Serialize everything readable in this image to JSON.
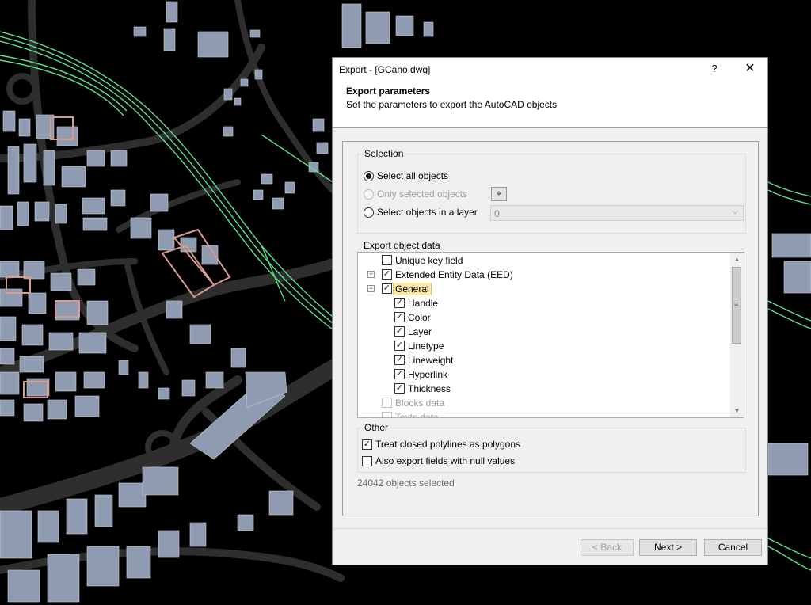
{
  "dialog": {
    "title": "Export - [GCano.dwg]",
    "help": "?",
    "close": "✕",
    "header_title": "Export parameters",
    "header_subtitle": "Set the parameters to export the AutoCAD objects"
  },
  "selection": {
    "group_label": "Selection",
    "all_objects": "Select all objects",
    "only_selected": "Only selected objects",
    "in_layer": "Select objects in a layer",
    "layer_value": "0",
    "selected_option": "all_objects"
  },
  "export_data": {
    "group_label": "Export object data",
    "items": [
      {
        "label": "Unique key field",
        "checked": false,
        "disabled": false
      },
      {
        "label": "Extended Entity Data (EED)",
        "checked": true,
        "disabled": false
      },
      {
        "label": "General",
        "checked": true,
        "disabled": false
      },
      {
        "label": "Handle",
        "checked": true,
        "disabled": false
      },
      {
        "label": "Color",
        "checked": true,
        "disabled": false
      },
      {
        "label": "Layer",
        "checked": true,
        "disabled": false
      },
      {
        "label": "Linetype",
        "checked": true,
        "disabled": false
      },
      {
        "label": "Lineweight",
        "checked": true,
        "disabled": false
      },
      {
        "label": "Hyperlink",
        "checked": true,
        "disabled": false
      },
      {
        "label": "Thickness",
        "checked": true,
        "disabled": false
      },
      {
        "label": "Blocks data",
        "checked": false,
        "disabled": true
      },
      {
        "label": "Texts data",
        "checked": false,
        "disabled": true
      }
    ]
  },
  "other": {
    "group_label": "Other",
    "closed_polylines": "Treat closed polylines as polygons",
    "closed_polylines_checked": true,
    "null_values": "Also export fields with null values",
    "null_values_checked": false
  },
  "status_text": "24042 objects selected",
  "buttons": {
    "back": "< Back",
    "next": "Next >",
    "cancel": "Cancel"
  },
  "colors": {
    "map_background": "#000000",
    "building_fill": "#8e9bb0",
    "road_color": "#2f2f2f",
    "highway_color": "#5be08a",
    "highlight_building": "#d99a8f"
  }
}
